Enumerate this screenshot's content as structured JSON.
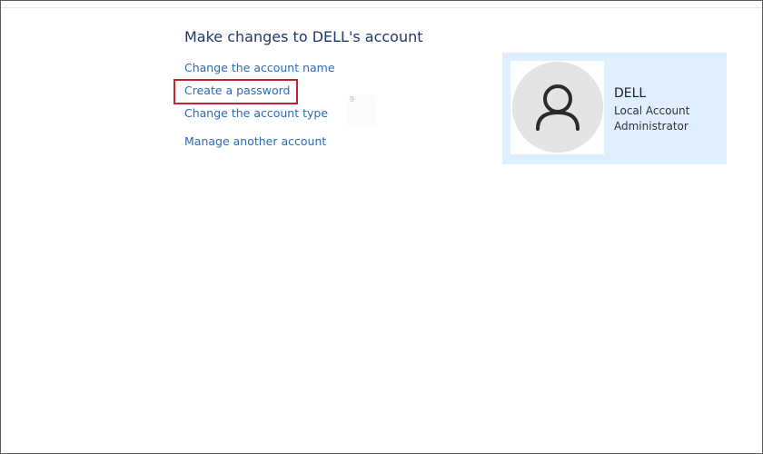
{
  "header": {
    "title": "Make changes to DELL's account"
  },
  "tasks": [
    {
      "label": "Change the account name"
    },
    {
      "label": "Create a password"
    },
    {
      "label": "Change the account type"
    },
    {
      "label": "Manage another account"
    }
  ],
  "account": {
    "name": "DELL",
    "type": "Local Account",
    "role": "Administrator",
    "avatar_icon": "user-icon"
  },
  "colors": {
    "link": "#2a6bb8",
    "title": "#1e3a6d",
    "card_bg": "#dfefff",
    "highlight": "#c8202f"
  }
}
